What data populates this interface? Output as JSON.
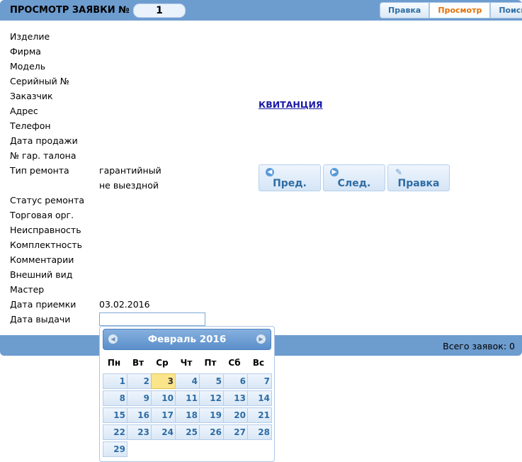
{
  "header": {
    "title": "ПРОСМОТР ЗАЯВКИ №",
    "request_number": "1",
    "tabs": [
      {
        "label": "Правка",
        "active": false
      },
      {
        "label": "Просмотр",
        "active": true
      },
      {
        "label": "Поиск",
        "active": false
      }
    ]
  },
  "fields": {
    "product": {
      "label": "Изделие",
      "value": ""
    },
    "firm": {
      "label": "Фирма",
      "value": ""
    },
    "model": {
      "label": "Модель",
      "value": ""
    },
    "serial": {
      "label": "Серийный №",
      "value": ""
    },
    "customer": {
      "label": "Заказчик",
      "value": ""
    },
    "address": {
      "label": "Адрес",
      "value": ""
    },
    "phone": {
      "label": "Телефон",
      "value": ""
    },
    "sale_date": {
      "label": "Дата продажи",
      "value": ""
    },
    "warranty_no": {
      "label": "№ гар. талона",
      "value": ""
    },
    "repair_type": {
      "label": "Тип ремонта",
      "value": "гарантийный",
      "value2": "не выездной"
    },
    "repair_status": {
      "label": "Статус ремонта",
      "value": ""
    },
    "trade_org": {
      "label": "Торговая орг.",
      "value": ""
    },
    "defect": {
      "label": "Неисправность",
      "value": ""
    },
    "completeness": {
      "label": "Комплектность",
      "value": ""
    },
    "comments": {
      "label": "Комментарии",
      "value": ""
    },
    "appearance": {
      "label": "Внешний вид",
      "value": ""
    },
    "master": {
      "label": "Мастер",
      "value": ""
    },
    "receive_date": {
      "label": "Дата приемки",
      "value": "03.02.2016"
    },
    "issue_date": {
      "label": "Дата выдачи",
      "value": ""
    }
  },
  "receipt_link": "КВИТАНЦИЯ",
  "buttons": {
    "prev": {
      "label": "Пред.",
      "icon": "arrow-left-icon"
    },
    "next": {
      "label": "След.",
      "icon": "arrow-right-icon"
    },
    "edit": {
      "label": "Правка",
      "icon": "pencil-icon"
    }
  },
  "footer": {
    "total_label": "Всего заявок: 0"
  },
  "calendar": {
    "month_title": "Февраль 2016",
    "weekdays": [
      "Пн",
      "Вт",
      "Ср",
      "Чт",
      "Пт",
      "Сб",
      "Вс"
    ],
    "today": "3",
    "days": [
      "1",
      "2",
      "3",
      "4",
      "5",
      "6",
      "7",
      "8",
      "9",
      "10",
      "11",
      "12",
      "13",
      "14",
      "15",
      "16",
      "17",
      "18",
      "19",
      "20",
      "21",
      "22",
      "23",
      "24",
      "25",
      "26",
      "27",
      "28",
      "29"
    ]
  },
  "colors": {
    "bar": "#6d9ccf",
    "tab_active_text": "#e17009",
    "link": "#1a1aa6",
    "today_bg": "#fbe58b"
  }
}
